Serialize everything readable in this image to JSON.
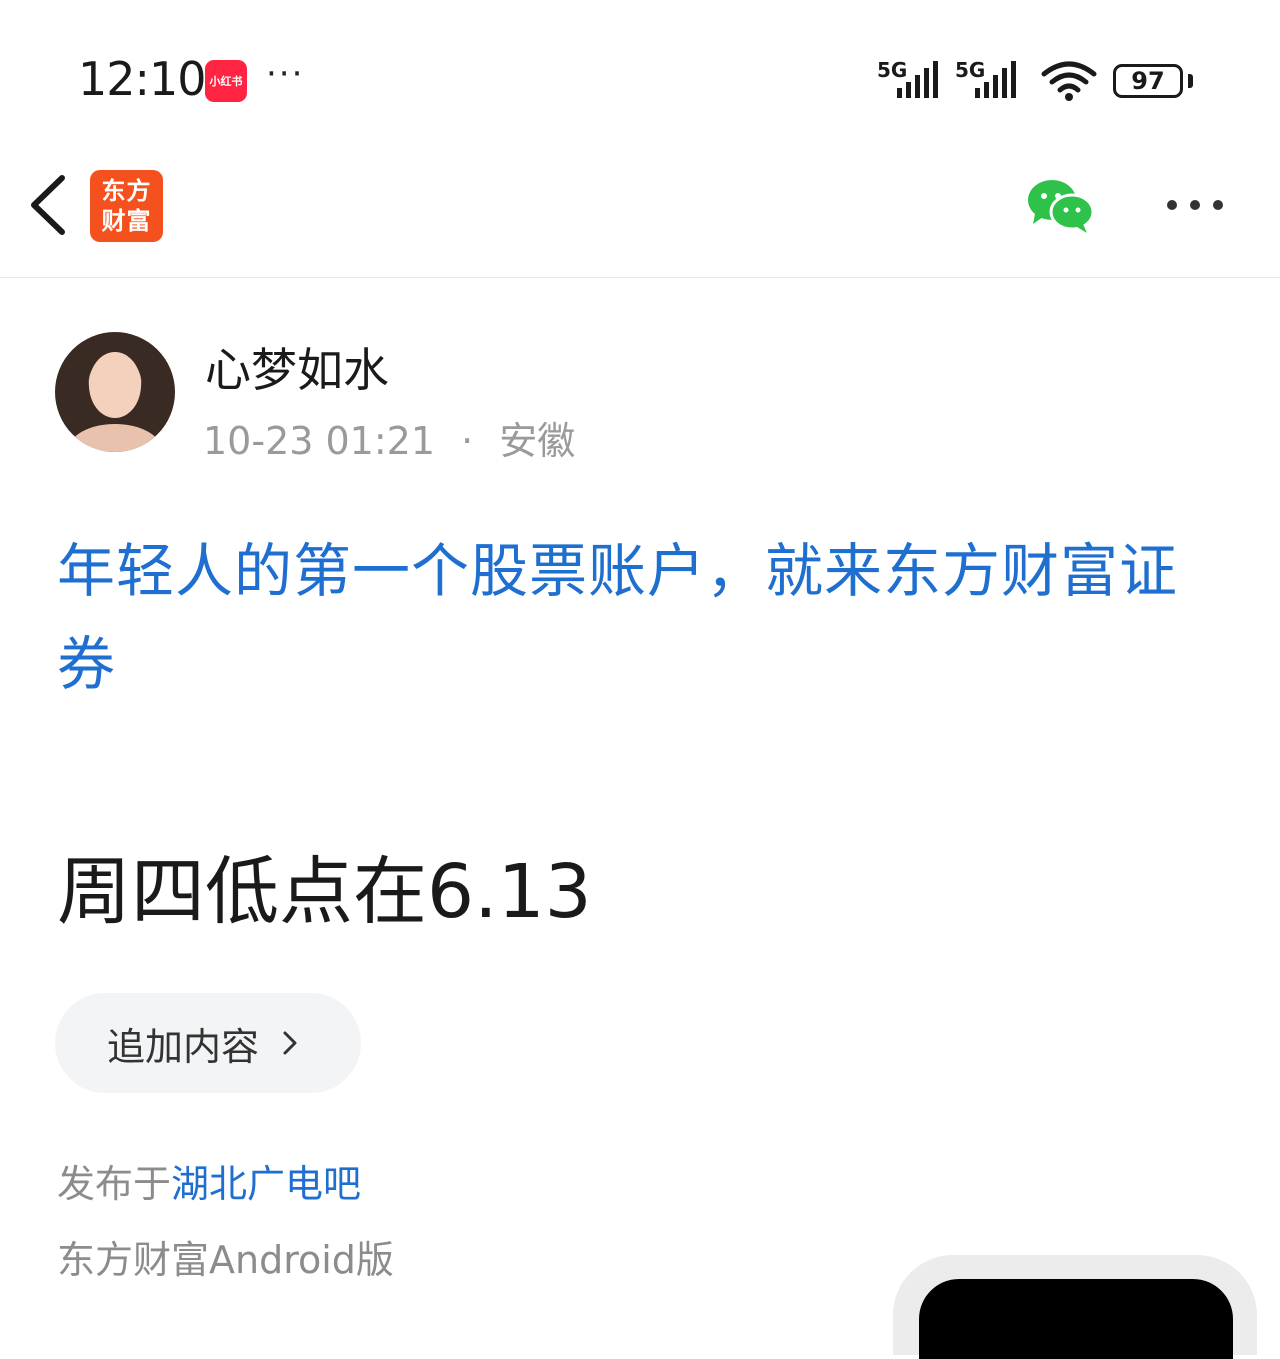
{
  "status_bar": {
    "time": "12:10",
    "notification_app": "小红书",
    "more": "···",
    "sim1": "5G",
    "sim2": "5G",
    "battery": "97"
  },
  "nav": {
    "app_logo_line1": "东方",
    "app_logo_line2": "财富",
    "brand_color": "#f4511e"
  },
  "post": {
    "author_name": "心梦如水",
    "time": "10-23 01:21",
    "separator": "·",
    "location": "安徽",
    "promo_text": "年轻人的第一个股票账户，就来东方财富证券",
    "content": "周四低点在6.13",
    "append_label": "追加内容",
    "published_prefix": "发布于",
    "forum_name": "湖北广电吧",
    "client": "东方财富Android版"
  },
  "colors": {
    "link": "#1e6fd0",
    "meta": "#9a9a9a",
    "wechat": "#2ec24a"
  }
}
